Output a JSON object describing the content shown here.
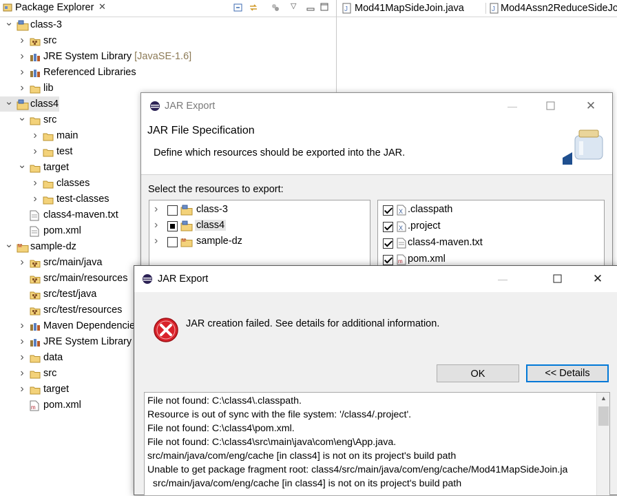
{
  "package_explorer": {
    "title": "Package Explorer",
    "tree": [
      {
        "label": "class-3",
        "deco": "",
        "icon": "project",
        "expanded": true,
        "depth": 0
      },
      {
        "label": "src",
        "deco": "",
        "icon": "pkg-folder",
        "expanded": false,
        "depth": 1
      },
      {
        "label": "JRE System Library",
        "deco": " [JavaSE-1.6]",
        "icon": "library",
        "expanded": false,
        "depth": 1
      },
      {
        "label": "Referenced Libraries",
        "deco": "",
        "icon": "library",
        "expanded": false,
        "depth": 1
      },
      {
        "label": "lib",
        "deco": "",
        "icon": "folder",
        "expanded": false,
        "depth": 1
      },
      {
        "label": "class4",
        "deco": "",
        "icon": "project",
        "expanded": true,
        "depth": 0,
        "selected": true
      },
      {
        "label": "src",
        "deco": "",
        "icon": "folder",
        "expanded": true,
        "depth": 1
      },
      {
        "label": "main",
        "deco": "",
        "icon": "folder",
        "expanded": false,
        "depth": 2
      },
      {
        "label": "test",
        "deco": "",
        "icon": "folder",
        "expanded": false,
        "depth": 2
      },
      {
        "label": "target",
        "deco": "",
        "icon": "folder",
        "expanded": true,
        "depth": 1
      },
      {
        "label": "classes",
        "deco": "",
        "icon": "folder",
        "expanded": false,
        "depth": 2
      },
      {
        "label": "test-classes",
        "deco": "",
        "icon": "folder",
        "expanded": false,
        "depth": 2
      },
      {
        "label": "class4-maven.txt",
        "deco": "",
        "icon": "file",
        "expanded": null,
        "depth": 1
      },
      {
        "label": "pom.xml",
        "deco": "",
        "icon": "file",
        "expanded": null,
        "depth": 1
      },
      {
        "label": "sample-dz",
        "deco": "",
        "icon": "maven-project",
        "expanded": true,
        "depth": 0
      },
      {
        "label": "src/main/java",
        "deco": "",
        "icon": "pkg-folder",
        "expanded": false,
        "depth": 1
      },
      {
        "label": "src/main/resources",
        "deco": "",
        "icon": "pkg-folder",
        "expanded": null,
        "depth": 1
      },
      {
        "label": "src/test/java",
        "deco": "",
        "icon": "pkg-folder",
        "expanded": null,
        "depth": 1
      },
      {
        "label": "src/test/resources",
        "deco": "",
        "icon": "pkg-folder",
        "expanded": null,
        "depth": 1
      },
      {
        "label": "Maven Dependencies",
        "deco": "",
        "icon": "library",
        "expanded": false,
        "depth": 1
      },
      {
        "label": "JRE System Library",
        "deco": "",
        "icon": "library",
        "expanded": false,
        "depth": 1
      },
      {
        "label": "data",
        "deco": "",
        "icon": "folder",
        "expanded": false,
        "depth": 1
      },
      {
        "label": "src",
        "deco": "",
        "icon": "folder",
        "expanded": false,
        "depth": 1
      },
      {
        "label": "target",
        "deco": "",
        "icon": "folder",
        "expanded": false,
        "depth": 1
      },
      {
        "label": "pom.xml",
        "deco": "",
        "icon": "maven-file",
        "expanded": null,
        "depth": 1
      }
    ]
  },
  "editor_tabs": [
    "Mod41MapSideJoin.java",
    "Mod4Assn2ReduceSideJo"
  ],
  "jar_dialog": {
    "title": "JAR Export",
    "heading": "JAR File Specification",
    "description": "Define which resources should be exported into the JAR.",
    "select_label": "Select the resources to export:",
    "projects": [
      {
        "label": "class-3",
        "state": "unchecked",
        "selected": false
      },
      {
        "label": "class4",
        "state": "partial",
        "selected": true
      },
      {
        "label": "sample-dz",
        "state": "unchecked",
        "selected": false
      }
    ],
    "files": [
      {
        "label": ".classpath",
        "checked": true,
        "icon": "x-file-icon"
      },
      {
        "label": ".project",
        "checked": true,
        "icon": "x-file-icon"
      },
      {
        "label": "class4-maven.txt",
        "checked": true,
        "icon": "text-file-icon"
      },
      {
        "label": "pom.xml",
        "checked": true,
        "icon": "maven-file-icon"
      }
    ]
  },
  "error_dialog": {
    "title": "JAR Export",
    "message": "JAR creation failed. See details for additional information.",
    "ok_label": "OK",
    "details_label": "<< Details",
    "details": [
      "File not found: C:\\class4\\.classpath.",
      "Resource is out of sync with the file system: '/class4/.project'.",
      "File not found: C:\\class4\\pom.xml.",
      "File not found: C:\\class4\\src\\main\\java\\com\\eng\\App.java.",
      "src/main/java/com/eng/cache [in class4] is not on its project's build path",
      "Unable to get package fragment root: class4/src/main/java/com/eng/cache/Mod41MapSideJoin.ja",
      "  src/main/java/com/eng/cache [in class4] is not on its project's build path"
    ]
  },
  "colors": {
    "error_red": "#d9222a",
    "accent_blue": "#0078d7",
    "folder_yellow": "#e8c15a",
    "selection_gray": "#e5e5e5"
  }
}
